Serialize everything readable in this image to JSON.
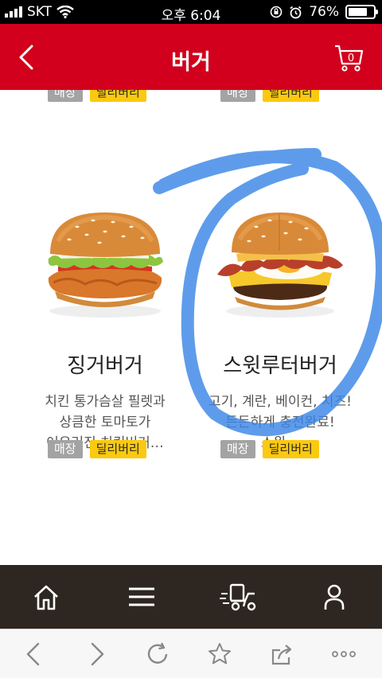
{
  "status": {
    "carrier": "SKT",
    "time": "오후 6:04",
    "battery": "76%"
  },
  "header": {
    "title": "버거",
    "cart_count": "0"
  },
  "tags": {
    "store": "매장",
    "delivery": "딜리버리"
  },
  "products": [
    {
      "name": "징거버거",
      "desc_lines": [
        "치킨 통가슴살 필렛과",
        "상큼한 토마토가",
        "어우러진 치킨버거…"
      ]
    },
    {
      "name": "스윗루터버거",
      "desc_lines": [
        "고기, 계란, 베이컨, 치즈!",
        "든든하게 충전완료!",
        "스윗…"
      ]
    }
  ],
  "colors": {
    "header_red": "#d2001c",
    "delivery_yellow": "#fbc90f",
    "store_gray": "#a3a3a3",
    "nav_dark": "#2e2721",
    "annotation_blue": "#3a86e6"
  },
  "icons": {
    "header_left": "back-chevron-icon",
    "header_right": "cart-icon",
    "nav": [
      "home-icon",
      "menu-icon",
      "delivery-icon",
      "person-icon"
    ],
    "browser": [
      "browser-back-icon",
      "browser-forward-icon",
      "reload-icon",
      "bookmark-star-icon",
      "share-icon",
      "more-icon"
    ]
  }
}
